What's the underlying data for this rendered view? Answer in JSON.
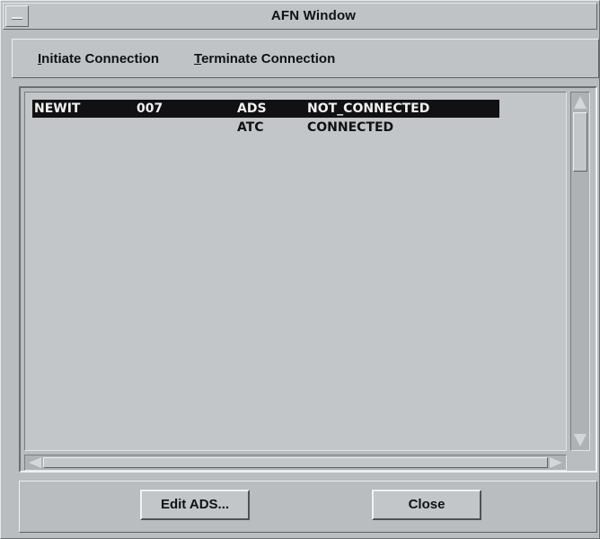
{
  "window": {
    "title": "AFN Window"
  },
  "menu": {
    "initiate": {
      "mnemonic": "I",
      "rest": "nitiate Connection"
    },
    "terminate": {
      "mnemonic": "T",
      "rest": "erminate Connection"
    }
  },
  "connections": [
    {
      "callsign": "NEWIT",
      "number": "007",
      "type": "ADS",
      "status": "NOT_CONNECTED",
      "selected": true
    },
    {
      "callsign": "",
      "number": "",
      "type": "ATC",
      "status": "CONNECTED",
      "selected": false
    }
  ],
  "buttons": {
    "edit": "Edit ADS...",
    "close": "Close"
  },
  "colors": {
    "background": "#b9bdbf",
    "selection": "#111111",
    "selection_text": "#f2f2f2"
  }
}
